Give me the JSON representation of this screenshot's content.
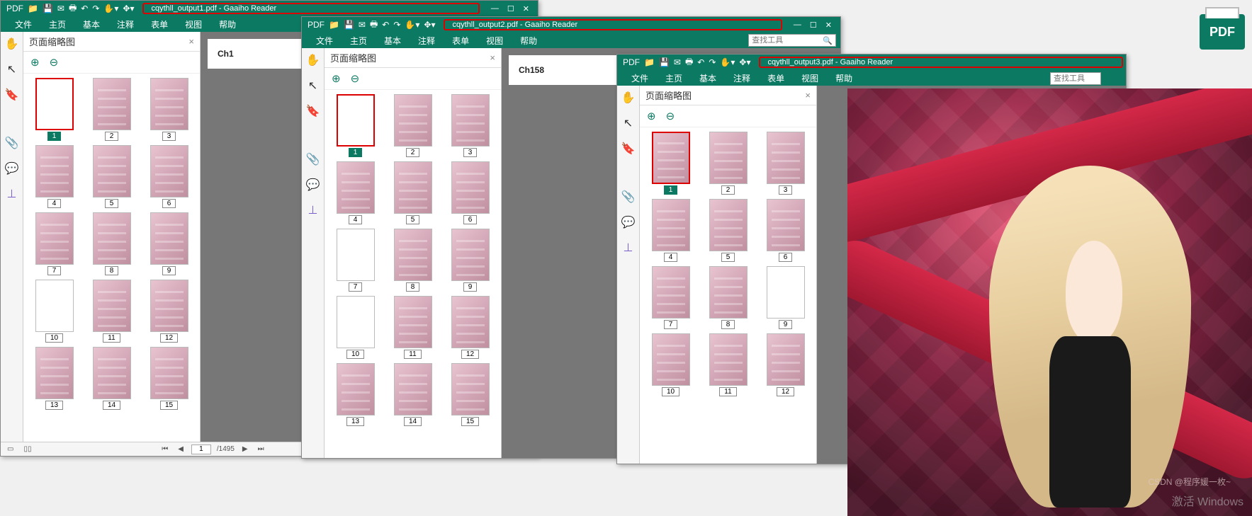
{
  "app_name": "Gaaiho Reader",
  "windows": [
    {
      "title": "cqythll_output1.pdf - Gaaiho Reader",
      "doc_label": "Ch1",
      "page_current": "1",
      "page_total": "/1495",
      "selected_page": 1,
      "thumb_count": 15
    },
    {
      "title": "cqythll_output2.pdf - Gaaiho Reader",
      "doc_label": "Ch158",
      "selected_page": 1,
      "thumb_count": 15
    },
    {
      "title": "cqythll_output3.pdf - Gaaiho Reader",
      "selected_page": 1,
      "thumb_count": 12
    }
  ],
  "menu": {
    "file": "文件",
    "home": "主页",
    "basic": "基本",
    "annotate": "注释",
    "form": "表单",
    "view": "视图",
    "help": "帮助"
  },
  "panel": {
    "title": "页面缩略图",
    "close": "×"
  },
  "search": {
    "placeholder": "查找工具"
  },
  "zoom": {
    "in": "⊕",
    "out": "⊖"
  },
  "pdf_badge": "PDF",
  "watermark": "激活 Windows",
  "csdn": "CSDN @程序媛一枚~",
  "toolbar_icons": [
    "PDF",
    "📁",
    "💾",
    "✉",
    "🖶",
    "↶",
    "↷",
    "✋▾",
    "✥▾"
  ],
  "wincontrols": {
    "min": "—",
    "max": "☐",
    "close": "✕"
  },
  "left_tools": {
    "hand": "✋",
    "arrow": "↖",
    "bookmark": "🔖",
    "clip": "📎",
    "comment": "💬",
    "stamp": "⊥"
  },
  "nav": {
    "first": "⏮",
    "prev": "◀",
    "next": "▶",
    "last": "⏭",
    "layout1": "▭",
    "layout2": "▯▯"
  }
}
